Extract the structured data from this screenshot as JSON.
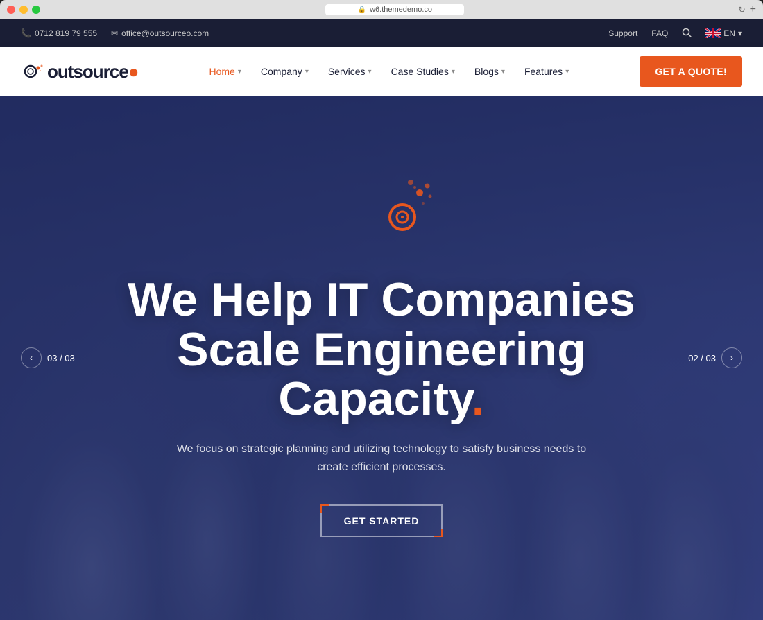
{
  "window": {
    "url": "w6.themedemo.co",
    "new_tab_icon": "+"
  },
  "topbar": {
    "phone": "0712 819 79 555",
    "email": "office@outsourceo.com",
    "support": "Support",
    "faq": "FAQ",
    "search_icon": "🔍",
    "lang": "EN"
  },
  "nav": {
    "logo_text_prefix": "utsource",
    "logo_brand": "outsource",
    "menu_items": [
      {
        "label": "Home",
        "active": true,
        "has_dropdown": true
      },
      {
        "label": "Company",
        "active": false,
        "has_dropdown": true
      },
      {
        "label": "Services",
        "active": false,
        "has_dropdown": true
      },
      {
        "label": "Case Studies",
        "active": false,
        "has_dropdown": true
      },
      {
        "label": "Blogs",
        "active": false,
        "has_dropdown": true
      },
      {
        "label": "Features",
        "active": false,
        "has_dropdown": true
      }
    ],
    "cta_button": "Get A Quote!"
  },
  "hero": {
    "title_line1": "We Help IT Companies",
    "title_line2": "Scale Engineering",
    "title_line3": "Capacity",
    "title_dot": ".",
    "subtitle": "We focus on strategic planning and utilizing technology to satisfy business needs to create efficient processes.",
    "cta_label": "Get Started",
    "slide_left": "03 / 03",
    "slide_right": "02 / 03"
  }
}
